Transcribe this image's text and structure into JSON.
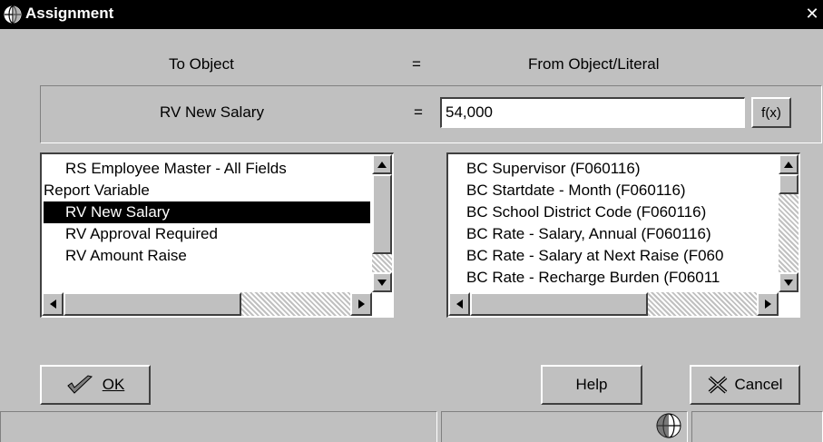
{
  "window": {
    "title": "Assignment",
    "close_glyph": "✕"
  },
  "headers": {
    "to_object": "To Object",
    "equals": "=",
    "from_object": "From Object/Literal"
  },
  "assignment": {
    "to_value": "RV New Salary",
    "equals": "=",
    "from_value": "54,000",
    "fx_label": "f(x)"
  },
  "left_list": {
    "items": [
      {
        "text": "RS Employee Master - All Fields",
        "indent": true,
        "selected": false
      },
      {
        "text": "Report Variable",
        "indent": false,
        "selected": false
      },
      {
        "text": "RV New Salary",
        "indent": true,
        "selected": true
      },
      {
        "text": "RV Approval Required",
        "indent": true,
        "selected": false
      },
      {
        "text": "RV Amount Raise",
        "indent": true,
        "selected": false
      }
    ]
  },
  "right_list": {
    "items": [
      {
        "text": "BC Supervisor (F060116)"
      },
      {
        "text": "BC Startdate - Month (F060116)"
      },
      {
        "text": "BC School District Code (F060116)"
      },
      {
        "text": "BC Rate - Salary, Annual (F060116)"
      },
      {
        "text": "BC Rate - Salary at Next Raise (F060"
      },
      {
        "text": "BC Rate - Recharge Burden (F06011"
      }
    ]
  },
  "buttons": {
    "ok": "OK",
    "help": "Help",
    "cancel": "Cancel"
  },
  "icons": {
    "window": "globe-icon",
    "ok": "checkmark-icon",
    "cancel": "cancel-x-icon",
    "status": "globe-icon"
  },
  "colors": {
    "window_bg": "#c0c0c0",
    "titlebar": "#000000",
    "selection": "#000000"
  }
}
